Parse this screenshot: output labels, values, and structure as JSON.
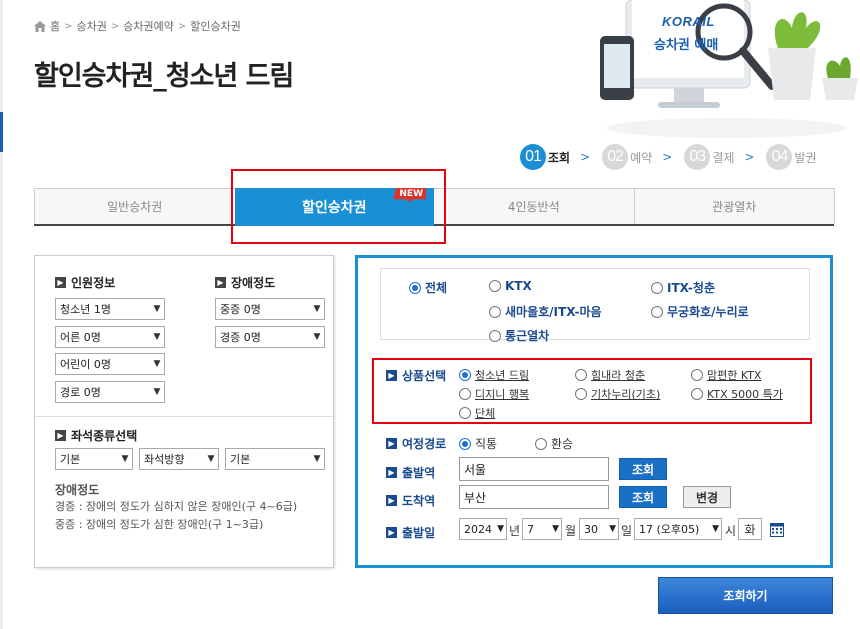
{
  "breadcrumb": [
    "홈",
    "승차권",
    "승차권예약",
    "할인승차권"
  ],
  "page_title": "할인승차권_청소년 드림",
  "banner": {
    "brand": "KORAIL",
    "caption": "승차권 예매"
  },
  "steps": [
    {
      "num": "01",
      "label": "조회"
    },
    {
      "num": "02",
      "label": "예약"
    },
    {
      "num": "03",
      "label": "결제"
    },
    {
      "num": "04",
      "label": "발권"
    }
  ],
  "tabs": [
    "일반승차권",
    "할인승차권",
    "4인동반석",
    "관광열차"
  ],
  "new_badge": "NEW",
  "left": {
    "passenger_title": "인원정보",
    "passengers": [
      "청소년 1명",
      "어른 0명",
      "어린이 0명",
      "경로 0명"
    ],
    "disability_title": "장애정도",
    "disability": [
      "중증 0명",
      "경증 0명"
    ],
    "seat_title": "좌석종류선택",
    "seat_selects": [
      "기본",
      "좌석방향",
      "기본"
    ],
    "disab_info_title": "장애정도",
    "disab_info_lines": [
      "경증 : 장애의 정도가 심하지 않은 장애인(구 4~6급)",
      "중증 : 장애의 정도가 심한 장애인(구 1~3급)"
    ]
  },
  "trains": [
    "전체",
    "KTX",
    "ITX-청춘",
    "새마을호/ITX-마음",
    "무궁화호/누리로",
    "통근열차"
  ],
  "product": {
    "label": "상품선택",
    "options": [
      "청소년 드림",
      "힘내라 청춘",
      "맘편한 KTX",
      "디지니 행복",
      "기차누리(기초)",
      "KTX 5000 특가",
      "단체"
    ]
  },
  "route": {
    "label": "여정경로",
    "options": [
      "직통",
      "환승"
    ]
  },
  "departure": {
    "label": "출발역",
    "value": "서울",
    "btn": "조회"
  },
  "arrival": {
    "label": "도착역",
    "value": "부산",
    "btn": "조회",
    "swap": "변경"
  },
  "date": {
    "label": "출발일",
    "year": "2024",
    "year_unit": "년",
    "month": "7",
    "month_unit": "월",
    "day": "30",
    "day_unit": "일",
    "hour": "17 (오후05)",
    "hour_unit": "시",
    "weekday": "화"
  },
  "search_button": "조회하기",
  "colors": {
    "accent": "#1a8fd3",
    "highlight": "#e60012",
    "label": "#1a4a8f"
  }
}
